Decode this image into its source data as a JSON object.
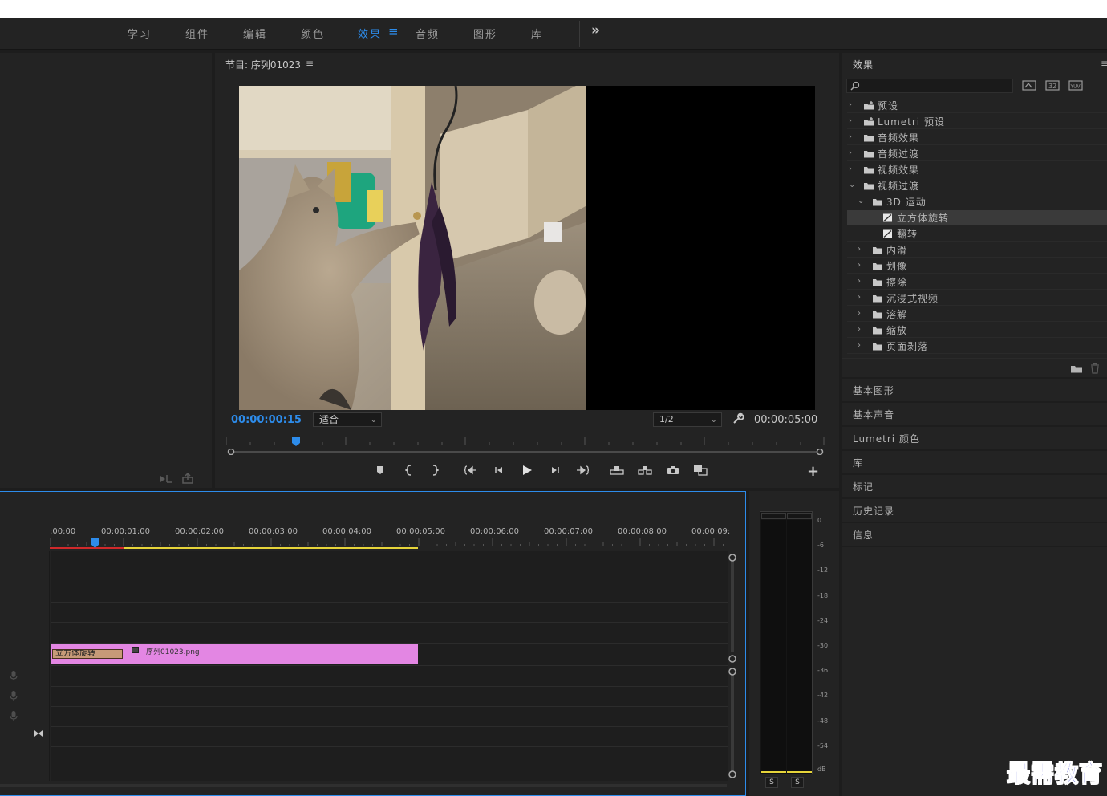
{
  "workspaces": {
    "items": [
      {
        "label": "学习"
      },
      {
        "label": "组件"
      },
      {
        "label": "编辑"
      },
      {
        "label": "颜色"
      },
      {
        "label": "效果",
        "active": true
      },
      {
        "label": "音频"
      },
      {
        "label": "图形"
      },
      {
        "label": "库"
      }
    ],
    "more_icon": "double-chevron-right-icon"
  },
  "program_monitor": {
    "title": "节目: 序列01023",
    "menu_icon": "≡",
    "current_timecode": "00:00:00:15",
    "fit_label": "适合",
    "resolution_label": "1/2",
    "duration_timecode": "00:00:05:00"
  },
  "effects_panel": {
    "title": "效果",
    "menu_icon": "≡",
    "search_placeholder": "",
    "filter_buttons": [
      "accelerated-effects-icon",
      "32-bit-icon",
      "yuv-icon"
    ],
    "tree": [
      {
        "label": "预设",
        "depth": 0,
        "kind": "preset-folder",
        "expanded": false
      },
      {
        "label": "Lumetri 预设",
        "depth": 0,
        "kind": "preset-folder",
        "expanded": false
      },
      {
        "label": "音频效果",
        "depth": 0,
        "kind": "folder",
        "expanded": false
      },
      {
        "label": "音频过渡",
        "depth": 0,
        "kind": "folder",
        "expanded": false
      },
      {
        "label": "视频效果",
        "depth": 0,
        "kind": "folder",
        "expanded": false
      },
      {
        "label": "视频过渡",
        "depth": 0,
        "kind": "folder",
        "expanded": true
      },
      {
        "label": "3D 运动",
        "depth": 1,
        "kind": "folder",
        "expanded": true
      },
      {
        "label": "立方体旋转",
        "depth": 2,
        "kind": "effect",
        "selected": true
      },
      {
        "label": "翻转",
        "depth": 2,
        "kind": "effect"
      },
      {
        "label": "内滑",
        "depth": 1,
        "kind": "folder",
        "expanded": false
      },
      {
        "label": "划像",
        "depth": 1,
        "kind": "folder",
        "expanded": false
      },
      {
        "label": "擦除",
        "depth": 1,
        "kind": "folder",
        "expanded": false
      },
      {
        "label": "沉浸式视频",
        "depth": 1,
        "kind": "folder",
        "expanded": false
      },
      {
        "label": "溶解",
        "depth": 1,
        "kind": "folder",
        "expanded": false
      },
      {
        "label": "缩放",
        "depth": 1,
        "kind": "folder",
        "expanded": false
      },
      {
        "label": "页面剥落",
        "depth": 1,
        "kind": "folder",
        "expanded": false
      }
    ]
  },
  "side_panels": [
    {
      "label": "基本图形"
    },
    {
      "label": "基本声音"
    },
    {
      "label": "Lumetri 颜色"
    },
    {
      "label": "库"
    },
    {
      "label": "标记"
    },
    {
      "label": "历史记录"
    },
    {
      "label": "信息"
    }
  ],
  "timeline": {
    "ruler_labels": [
      ":00:00",
      "00:00:01:00",
      "00:00:02:00",
      "00:00:03:00",
      "00:00:04:00",
      "00:00:05:00",
      "00:00:06:00",
      "00:00:07:00",
      "00:00:08:00",
      "00:00:09:"
    ],
    "clips": {
      "transition_label": "立方体旋转",
      "main_label": "序列01023.png"
    }
  },
  "audio_meter": {
    "scale": [
      "0",
      "-6",
      "-12",
      "-18",
      "-24",
      "-30",
      "-36",
      "-42",
      "-48",
      "-54",
      "dB"
    ],
    "solo_left": "S",
    "solo_right": "S"
  },
  "watermark": "最需教育",
  "colors": {
    "accent": "#2d8ceb",
    "clip": "#e386e3",
    "transition": "#c79a78",
    "work_area": "#e6d43a",
    "render_bar": "#d0292b"
  }
}
